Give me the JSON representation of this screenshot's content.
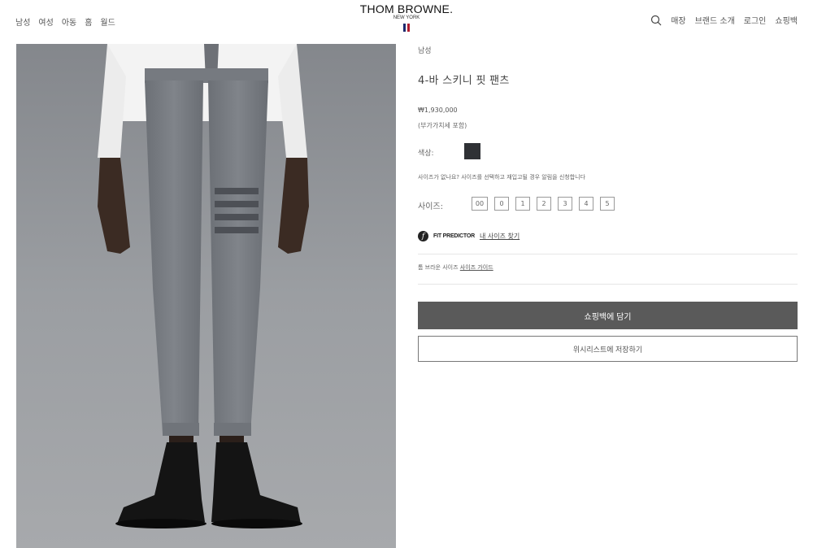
{
  "header": {
    "nav_left": [
      "남성",
      "여성",
      "아동",
      "홈",
      "월드"
    ],
    "logo": {
      "title": "THOM BROWNE.",
      "subtitle": "NEW YORK"
    },
    "nav_right": {
      "search_icon": "search-icon",
      "items": [
        "매장",
        "브랜드 소개",
        "로그인",
        "쇼핑백"
      ]
    },
    "flag_colors": [
      "#1c2a6e",
      "#ffffff",
      "#b01c2e"
    ]
  },
  "product": {
    "breadcrumb": "남성",
    "title": "4-바 스키니 핏 팬츠",
    "price": "₩1,930,000",
    "vat_note": "(부가가치세 포함)",
    "color_label": "색상:",
    "color_swatch": "#2f3135",
    "size_notice": "사이즈가 없나요? 사이즈를 선택하고 재입고될 경우 알림을 신청합니다",
    "size_label": "사이즈:",
    "sizes": [
      "00",
      "0",
      "1",
      "2",
      "3",
      "4",
      "5"
    ],
    "fit_predictor": {
      "icon": "fit-predictor-icon",
      "brand": "FIT PREDICTOR",
      "link": "내 사이즈 찾기"
    },
    "size_guide": {
      "prefix": "톰 브라운 사이즈",
      "link": "사이즈 가이드"
    },
    "add_to_bag": "쇼핑백에 담기",
    "wishlist": "위시리스트에 저장하기"
  }
}
